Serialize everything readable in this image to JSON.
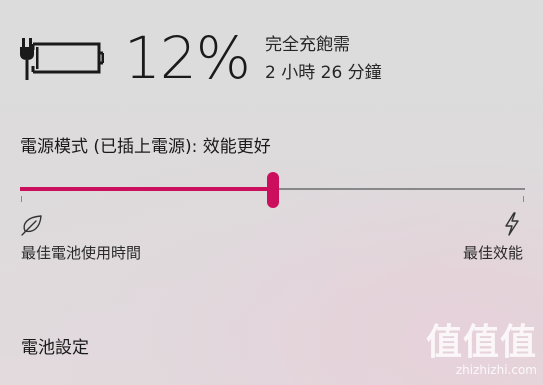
{
  "battery": {
    "icon": "battery-charging-icon",
    "percent_text": "12%",
    "status_line_1": "完全充飽需",
    "status_line_2": "2 小時 26 分鐘"
  },
  "power_mode": {
    "title": "電源模式 (已插上電源): 效能更好",
    "slider_value_fraction": 0.5,
    "left_icon": "leaf-icon",
    "right_icon": "lightning-bolt-icon",
    "left_label": "最佳電池使用時間",
    "right_label": "最佳效能"
  },
  "links": {
    "battery_settings": "電池設定"
  },
  "watermark": {
    "mark": "值值值",
    "url": "zhizhizhi.com"
  },
  "colors": {
    "accent": "#cc0f5d",
    "track": "#888888"
  }
}
